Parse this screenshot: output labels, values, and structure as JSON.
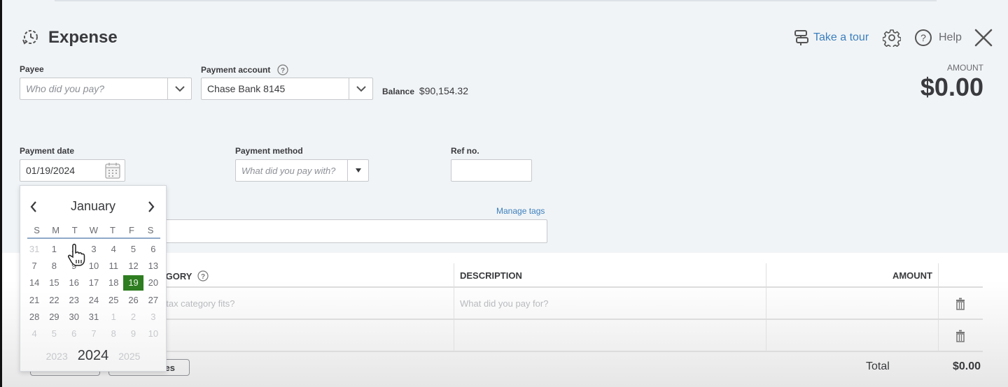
{
  "header": {
    "title": "Expense",
    "take_tour": "Take a tour",
    "help": "Help",
    "amount_label": "AMOUNT",
    "amount_value": "$0.00"
  },
  "form": {
    "payee": {
      "label": "Payee",
      "placeholder": "Who did you pay?"
    },
    "payment_account": {
      "label": "Payment account",
      "value": "Chase Bank 8145"
    },
    "balance": {
      "label": "Balance",
      "value": "$90,154.32"
    },
    "payment_date": {
      "label": "Payment date",
      "value": "01/19/2024"
    },
    "payment_method": {
      "label": "Payment method",
      "placeholder": "What did you pay with?"
    },
    "ref_no": {
      "label": "Ref no.",
      "value": ""
    },
    "manage_tags": "Manage tags"
  },
  "calendar": {
    "month": "January",
    "weekdays": [
      "S",
      "M",
      "T",
      "W",
      "T",
      "F",
      "S"
    ],
    "weeks": [
      [
        {
          "d": "31",
          "out": true
        },
        {
          "d": "1"
        },
        {
          "d": "2"
        },
        {
          "d": "3"
        },
        {
          "d": "4"
        },
        {
          "d": "5"
        },
        {
          "d": "6"
        }
      ],
      [
        {
          "d": "7"
        },
        {
          "d": "8"
        },
        {
          "d": "9"
        },
        {
          "d": "10"
        },
        {
          "d": "11"
        },
        {
          "d": "12"
        },
        {
          "d": "13"
        }
      ],
      [
        {
          "d": "14"
        },
        {
          "d": "15"
        },
        {
          "d": "16"
        },
        {
          "d": "17"
        },
        {
          "d": "18"
        },
        {
          "d": "19",
          "selected": true
        },
        {
          "d": "20"
        }
      ],
      [
        {
          "d": "21"
        },
        {
          "d": "22"
        },
        {
          "d": "23"
        },
        {
          "d": "24"
        },
        {
          "d": "25"
        },
        {
          "d": "26"
        },
        {
          "d": "27"
        }
      ],
      [
        {
          "d": "28"
        },
        {
          "d": "29"
        },
        {
          "d": "30"
        },
        {
          "d": "31"
        },
        {
          "d": "1",
          "out": true
        },
        {
          "d": "2",
          "out": true
        },
        {
          "d": "3",
          "out": true
        }
      ],
      [
        {
          "d": "4",
          "out": true
        },
        {
          "d": "5",
          "out": true
        },
        {
          "d": "6",
          "out": true
        },
        {
          "d": "7",
          "out": true
        },
        {
          "d": "8",
          "out": true
        },
        {
          "d": "9",
          "out": true
        },
        {
          "d": "10",
          "out": true
        }
      ]
    ],
    "prev_year": "2023",
    "current_year": "2024",
    "next_year": "2025",
    "selected_color": "#2e7d20"
  },
  "table": {
    "columns": {
      "category": "CATEGORY",
      "category_visible": "EGORY",
      "description": "DESCRIPTION",
      "amount": "AMOUNT"
    },
    "rows": [
      {
        "category_placeholder": "t tax category fits?",
        "description_placeholder": "What did you pay for?"
      },
      {
        "category_placeholder": "",
        "description_placeholder": ""
      }
    ],
    "total_label": "Total",
    "total_value": "$0.00",
    "button_partial_label": "es"
  },
  "colors": {
    "link": "#3b7fbe",
    "background": "#f1f4f6",
    "text": "#393a3d"
  }
}
